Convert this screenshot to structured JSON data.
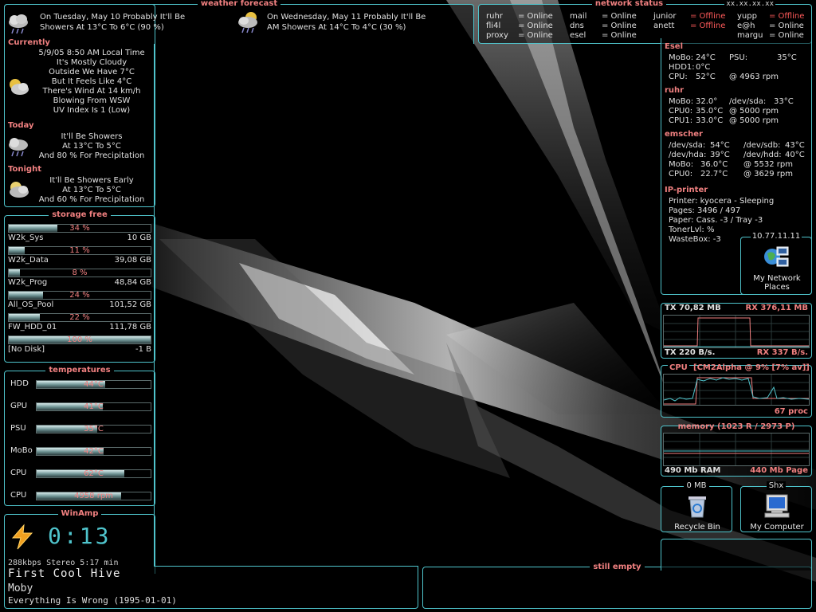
{
  "weather": {
    "title": "weather forecast",
    "tuesday_line1": "On Tuesday, May 10 Probably It'll Be",
    "tuesday_line2": "Showers At 13°C To 6°C (90 %)",
    "wednesday_line1": "On Wednesday, May 11 Probably It'll Be",
    "wednesday_line2": "AM Showers At 14°C To 4°C (30 %)",
    "currently_label": "Currently",
    "currently": [
      "5/9/05 8:50 AM Local Time",
      "It's Mostly Cloudy",
      "Outside We Have 7°C",
      "But It Feels Like 4°C",
      "There's Wind At 14 km/h",
      "Blowing From WSW",
      "UV Index Is 1 (Low)"
    ],
    "today_label": "Today",
    "today": [
      "It'll Be Showers",
      "At 13°C To 5°C",
      "And 80 % For Precipitation"
    ],
    "tonight_label": "Tonight",
    "tonight": [
      "It'll Be Showers Early",
      "At 13°C To 5°C",
      "And 60 % For Precipitation"
    ]
  },
  "network": {
    "title": "network status",
    "ip_mask": "xx.xx.xx.xx",
    "hosts": [
      {
        "name": "ruhr",
        "status": "= Online"
      },
      {
        "name": "fli4l",
        "status": "= Online"
      },
      {
        "name": "proxy",
        "status": "= Online"
      },
      {
        "name": "mail",
        "status": "= Online"
      },
      {
        "name": "dns",
        "status": "= Online"
      },
      {
        "name": "esel",
        "status": "= Online"
      },
      {
        "name": "junior",
        "status": "= Offline"
      },
      {
        "name": "anett",
        "status": "= Offline"
      },
      {
        "name": "yupp",
        "status": "= Offline"
      },
      {
        "name": "e@h",
        "status": "= Online"
      },
      {
        "name": "margu",
        "status": "= Online"
      }
    ]
  },
  "status": {
    "esel_label": "Esel",
    "esel": [
      [
        "MoBo:",
        "24°C",
        "PSU:",
        "35°C"
      ],
      [
        "HDD1:",
        "0°C",
        "",
        ""
      ],
      [
        "CPU:",
        "52°C",
        "@ 4963 rpm",
        ""
      ]
    ],
    "ruhr_label": "ruhr",
    "ruhr": [
      [
        "MoBo:",
        "32.0°",
        "/dev/sda:",
        "33°C"
      ],
      [
        "CPU0:",
        "35.0°C",
        "@ 5000 rpm",
        ""
      ],
      [
        "CPU1:",
        "33.0°C",
        "@ 5000 rpm",
        ""
      ]
    ],
    "emscher_label": "emscher",
    "emscher": [
      [
        "/dev/sda:",
        "54°C",
        "/dev/sdb:",
        "43°C"
      ],
      [
        "/dev/hda:",
        "39°C",
        "/dev/hdd:",
        "40°C"
      ],
      [
        "MoBo:",
        "36.0°C",
        "@ 5532 rpm",
        ""
      ],
      [
        "CPU0:",
        "22.7°C",
        "@ 3629 rpm",
        ""
      ]
    ],
    "printer_label": "IP-printer",
    "printer": [
      "Printer: kyocera - Sleeping",
      "Pages: 3496 / 497",
      "Paper:  Cass. -3 / Tray -3",
      "TonerLvl:    %",
      "WasteBox:  -3"
    ],
    "netplaces_ip": "10.77.11.11",
    "netplaces_label1": "My Network",
    "netplaces_label2": "Places"
  },
  "storage": {
    "title": "storage free",
    "drives": [
      {
        "pct_label": "34 %",
        "pct": 34,
        "name": "W2k_Sys",
        "size": "10 GB"
      },
      {
        "pct_label": "11 %",
        "pct": 11,
        "name": "W2k_Data",
        "size": "39,08 GB"
      },
      {
        "pct_label": "8 %",
        "pct": 8,
        "name": "W2k_Prog",
        "size": "48,84 GB"
      },
      {
        "pct_label": "24 %",
        "pct": 24,
        "name": "All_OS_Pool",
        "size": "101,52 GB"
      },
      {
        "pct_label": "22 %",
        "pct": 22,
        "name": "FW_HDD_01",
        "size": "111,78 GB"
      },
      {
        "pct_label": "100 %",
        "pct": 100,
        "name": "[No Disk]",
        "size": "-1 B"
      }
    ]
  },
  "temps": {
    "title": "temperatures",
    "rows": [
      {
        "label": "HDD",
        "value": "44°C",
        "pct": 60
      },
      {
        "label": "GPU",
        "value": "41°C",
        "pct": 58
      },
      {
        "label": "PSU",
        "value": "35°C",
        "pct": 53
      },
      {
        "label": "MoBo",
        "value": "42°C",
        "pct": 59
      },
      {
        "label": "CPU",
        "value": "62°C",
        "pct": 77
      },
      {
        "label": "CPU",
        "value": "4958 rpm",
        "pct": 74
      }
    ]
  },
  "winamp": {
    "title": "WinAmp",
    "time": "0:13",
    "info": "288kbps  Stereo 5:17 min",
    "track": "First Cool Hive",
    "artist": "Moby",
    "album": "Everything Is Wrong (1995-01-01)"
  },
  "netgraph": {
    "tx_total": "TX 70,82 MB",
    "rx_total": "RX 376,11 MB",
    "tx_rate": "TX 220 B/s.",
    "rx_rate": "RX 337 B/s."
  },
  "cpugraph": {
    "label": "CPU",
    "detail": "[CM2Alpha @ 9% [7% av]]",
    "procs": "67 proc"
  },
  "memgraph": {
    "label": "memory (1023 R / 2973 P)",
    "ram": "490 Mb RAM",
    "page": "440 Mb Page"
  },
  "desktop": {
    "recycle_size": "0 MB",
    "recycle_label": "Recycle Bin",
    "computer_top": "Shx",
    "computer_label": "My Computer",
    "still_empty": "still empty"
  }
}
